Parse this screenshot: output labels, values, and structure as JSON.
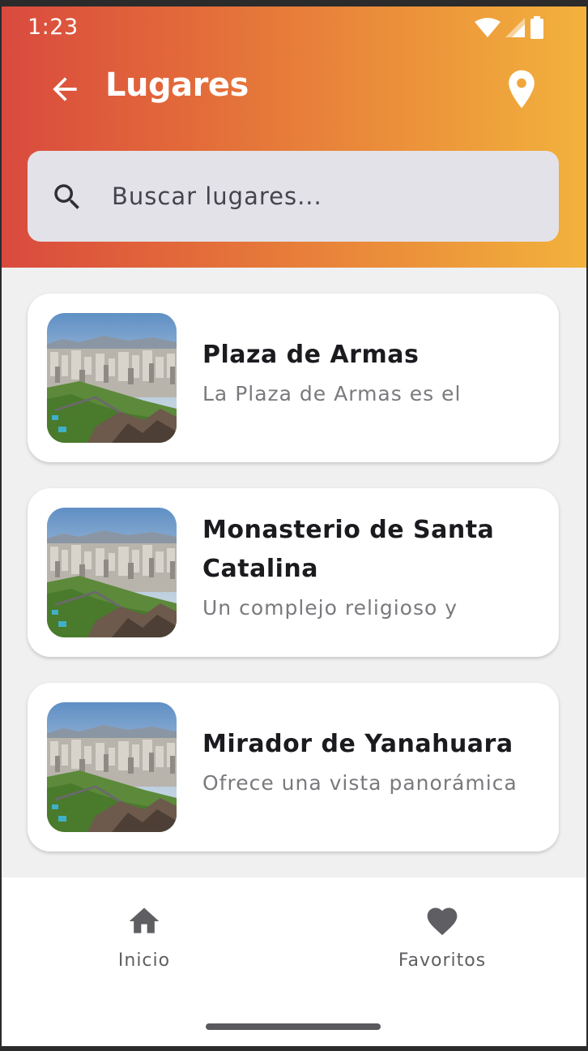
{
  "status_bar": {
    "time": "1:23"
  },
  "app_bar": {
    "title": "Lugares"
  },
  "search": {
    "placeholder": "Buscar lugares..."
  },
  "places": [
    {
      "title": "Plaza de Armas",
      "description": "La Plaza de Armas es el"
    },
    {
      "title": "Monasterio de Santa Catalina",
      "description": "Un complejo religioso y"
    },
    {
      "title": "Mirador de Yanahuara",
      "description": "Ofrece una vista panorámica"
    }
  ],
  "bottom_nav": {
    "items": [
      {
        "label": "Inicio",
        "icon": "home-icon"
      },
      {
        "label": "Favoritos",
        "icon": "heart-icon"
      }
    ]
  },
  "colors": {
    "header_gradient_start": "#d94a3e",
    "header_gradient_end": "#f2b23c",
    "background": "#f0f0f0",
    "card": "#ffffff",
    "search_bg": "#e3e2e8"
  }
}
